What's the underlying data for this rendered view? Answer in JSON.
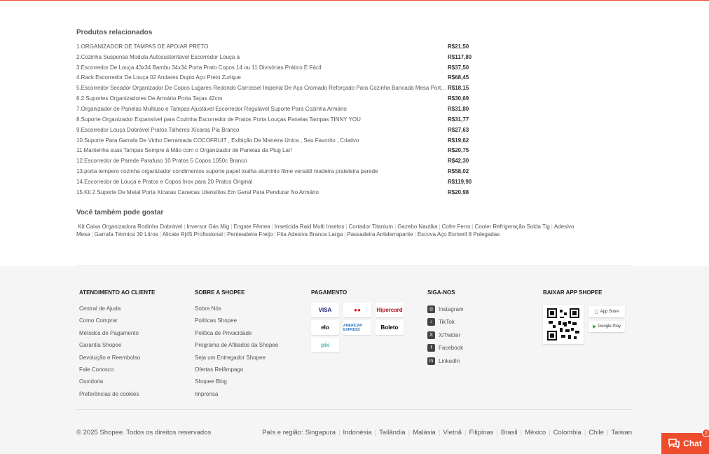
{
  "related": {
    "title": "Produtos relacionados",
    "items": [
      {
        "name": "1.ORGANIZADOR DE TAMPAS DE APOIAR PRETO",
        "price": "R$21,50"
      },
      {
        "name": "2.Cozinha Suspensa Modula Autosustentavel Escorredor Louça a",
        "price": "R$117,80"
      },
      {
        "name": "3.Escorredor De Louça 43x34 Bambu 34x34 Porta Prato Copos 14 ou 11 Divisórias Prático E Fácil",
        "price": "R$37,50"
      },
      {
        "name": "4.Rack Escorredor De Louça 02 Andares Duplo Aço Preto Zurique",
        "price": "R$68,45"
      },
      {
        "name": "5.Escorredor Secador Organizador De Copos Lugares Redondo Carrossel Imperial De Aço Cromado Reforçado Para Cozinha Bancada Mesa Porta co...",
        "price": "R$18,15"
      },
      {
        "name": "6.2 Suportes Organizadores De Armário Porta Taças 42cm",
        "price": "R$30,69"
      },
      {
        "name": "7.Organizador de Panelas Multiuso e Tampas Ajustável Escorredor Regulável Suporte Para Cozinha Armário",
        "price": "R$31,80"
      },
      {
        "name": "8.Suporte Organizador Expansível para Cozinha Escorredor de Pratos Porta Louças Panelas Tampas TINNY YOU",
        "price": "R$31,77"
      },
      {
        "name": "9.Escorredor Louça Dobrável Pratos Talheres Xícaras Pia Branco",
        "price": "R$27,63"
      },
      {
        "name": "10.Suporte Para Garrafa De Vinho Derramada COCOFRUIT , Exibição De Maneira Única , Seu Favorito , Criativo",
        "price": "R$19,62"
      },
      {
        "name": "11.Mantenha suas Tampas Sempre à Mão com o Organizador de Panelas da Plug Lar!",
        "price": "R$20,75"
      },
      {
        "name": "12.Escorredor de Parede Parafuso 10 Pratos 5 Copos 1050c Branco",
        "price": "R$42,30"
      },
      {
        "name": "13.porta tempero cozinha organizador condimentos suporte papel toalha alumínio filme versátil madeira prateleira parede",
        "price": "R$58,02"
      },
      {
        "name": "14.Escorredor de Louça e Pratos e Copos Inox para 20 Pratos Original",
        "price": "R$119,90"
      },
      {
        "name": "15.Kit 2 Suporte De Metal Porta Xícaras Canecas Utensílios Em Geral Para Pendurar No Armário",
        "price": "R$20,98"
      }
    ]
  },
  "also_like": {
    "title": "Você também pode gostar",
    "tags": [
      "Kit Caixa Organizadora Rodinha Dobrável",
      "Inversor Gás Mig",
      "Engate Fêmea",
      "Inseticida Raid Multi Insetos",
      "Cortador Titanium",
      "Gazebo Nautika",
      "Cofre Ferro",
      "Cooler Refrigeração Solda Tig",
      "Adesivo Mesa",
      "Garrafa Térmica 30 Litros",
      "Alicate Rj45 Profissional",
      "Penteadeira Freijo",
      "Fita Adesiva Branca Larga",
      "Passadeira Antiderrapante",
      "Escova Aço Esmeril 8 Polegadas"
    ]
  },
  "footer": {
    "customer": {
      "title": "ATENDIMENTO AO CLIENTE",
      "links": [
        "Central de Ajuda",
        "Como Comprar",
        "Métodos de Pagamento",
        "Garantia Shopee",
        "Devolução e Reembolso",
        "Fale Conosco",
        "Ouvidoria",
        "Preferências de cookies"
      ]
    },
    "about": {
      "title": "SOBRE A SHOPEE",
      "links": [
        "Sobre Nós",
        "Políticas Shopee",
        "Política de Privacidade",
        "Programa de Afiliados da Shopee",
        "Seja um Entregador Shopee",
        "Ofertas Relâmpago",
        "Shopee Blog",
        "Imprensa"
      ]
    },
    "payment": {
      "title": "PAGAMENTO",
      "methods": [
        {
          "label": "VISA",
          "color": "#1a1f71"
        },
        {
          "label": "●●",
          "color": "#eb001b"
        },
        {
          "label": "Hipercard",
          "color": "#b3131b"
        },
        {
          "label": "elo",
          "color": "#000000"
        },
        {
          "label": "AMERICAN EXPRESS",
          "color": "#2e77bb"
        },
        {
          "label": "Boleto",
          "color": "#000000"
        },
        {
          "label": "pix",
          "color": "#32bcad"
        }
      ]
    },
    "social": {
      "title": "SIGA-NOS",
      "links": [
        {
          "label": "Instagram",
          "icon": "instagram-icon",
          "glyph": "◎"
        },
        {
          "label": "TikTok",
          "icon": "tiktok-icon",
          "glyph": "♪"
        },
        {
          "label": "X/Twitter",
          "icon": "x-twitter-icon",
          "glyph": "X"
        },
        {
          "label": "Facebook",
          "icon": "facebook-icon",
          "glyph": "f"
        },
        {
          "label": "LinkedIn",
          "icon": "linkedin-icon",
          "glyph": "in"
        }
      ]
    },
    "app": {
      "title": "BAIXAR APP SHOPEE",
      "app_store": "App Store",
      "google_play": "Google Play"
    },
    "copyright": "© 2025 Shopee. Todos os direitos reservados",
    "region_label": "País e região:",
    "regions": [
      "Singapura",
      "Indonésia",
      "Tailândia",
      "Malásia",
      "Vietnã",
      "Filipinas",
      "Brasil",
      "México",
      "Colombia",
      "Chile",
      "Taiwan"
    ]
  },
  "chat": {
    "label": "Chat",
    "badge": "2",
    "color": "#ee4d2d"
  }
}
